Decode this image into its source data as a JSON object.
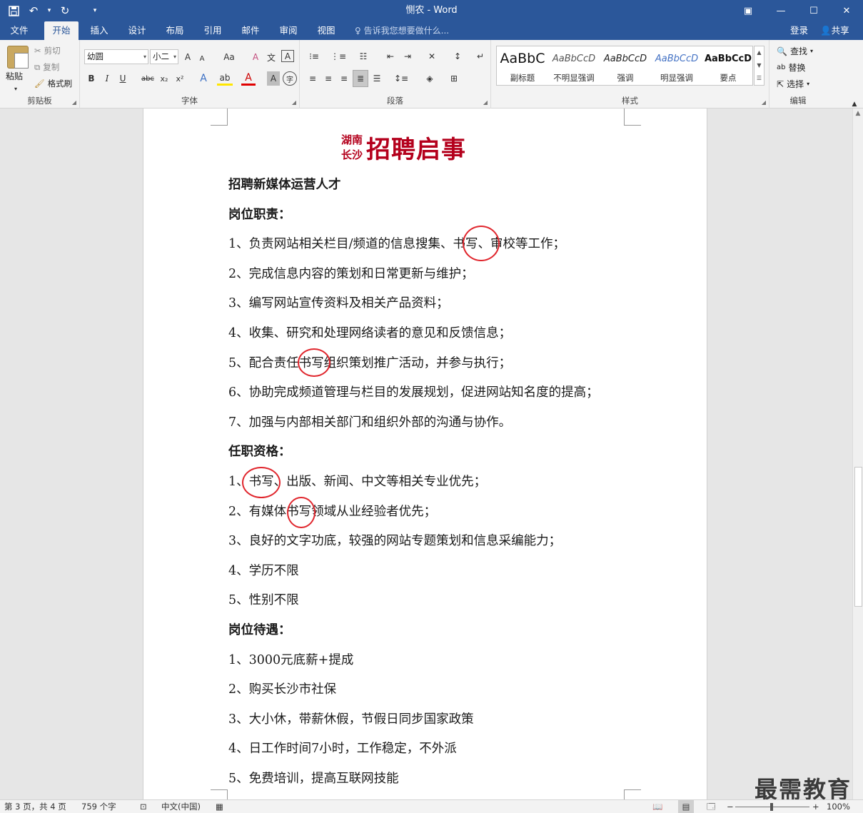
{
  "window": {
    "title": "恻农 - Word",
    "quick_access": {
      "save_icon": "save-icon",
      "undo_icon": "undo-icon",
      "redo_icon": "redo-icon",
      "customize_icon": "customize-qat-icon"
    },
    "controls": {
      "ribbon_display": "▣",
      "minimize": "—",
      "maximize": "☐",
      "close": "✕"
    }
  },
  "tabs": [
    {
      "label": "文件"
    },
    {
      "label": "开始"
    },
    {
      "label": "插入"
    },
    {
      "label": "设计"
    },
    {
      "label": "布局"
    },
    {
      "label": "引用"
    },
    {
      "label": "邮件"
    },
    {
      "label": "审阅"
    },
    {
      "label": "视图"
    }
  ],
  "tell_me": "告诉我您想要做什么...",
  "account": {
    "login": "登录",
    "share": "共享"
  },
  "ribbon": {
    "clipboard": {
      "paste": "粘贴",
      "cut": "剪切",
      "copy": "复制",
      "format_painter": "格式刷",
      "label": "剪贴板"
    },
    "font": {
      "font_name": "幼圆",
      "font_size": "小二",
      "grow": "A",
      "shrink": "A",
      "change_case": "Aa",
      "clear": "A",
      "phonetic": "文",
      "border_char": "A",
      "bold": "B",
      "italic": "I",
      "underline": "U",
      "strike": "abc",
      "subscript": "x₂",
      "superscript": "x²",
      "effects": "A",
      "highlight": "ab",
      "color": "A",
      "shading": "A",
      "enclose": "字",
      "label": "字体"
    },
    "paragraph": {
      "label": "段落"
    },
    "styles": {
      "items": [
        {
          "preview": "AaBbC",
          "name": "副标题"
        },
        {
          "preview": "AaBbCcD",
          "name": "不明显强调"
        },
        {
          "preview": "AaBbCcD",
          "name": "强调"
        },
        {
          "preview": "AaBbCcD",
          "name": "明显强调"
        },
        {
          "preview": "AaBbCcD",
          "name": "要点"
        }
      ],
      "label": "样式"
    },
    "editing": {
      "find": "查找",
      "replace": "替换",
      "select": "选择",
      "label": "编辑"
    }
  },
  "document": {
    "title_sub": "湖南长沙",
    "title_main": "招聘启事",
    "lines": [
      {
        "text": "招聘新媒体运营人才",
        "bold": true
      },
      {
        "text": "岗位职责：",
        "bold": true
      },
      {
        "text": "1、负责网站相关栏目/频道的信息搜集、书写、审校等工作；",
        "bold": false
      },
      {
        "text": "2、完成信息内容的策划和日常更新与维护；",
        "bold": false
      },
      {
        "text": "3、编写网站宣传资料及相关产品资料；",
        "bold": false
      },
      {
        "text": "4、收集、研究和处理网络读者的意见和反馈信息；",
        "bold": false
      },
      {
        "text": "5、配合责任书写组织策划推广活动，并参与执行；",
        "bold": false
      },
      {
        "text": "6、协助完成频道管理与栏目的发展规划，促进网站知名度的提高；",
        "bold": false
      },
      {
        "text": "7、加强与内部相关部门和组织外部的沟通与协作。",
        "bold": false
      },
      {
        "text": "任职资格：",
        "bold": true
      },
      {
        "text": "1、书写、出版、新闻、中文等相关专业优先；",
        "bold": false
      },
      {
        "text": "2、有媒体书写领域从业经验者优先；",
        "bold": false
      },
      {
        "text": "3、良好的文字功底，较强的网站专题策划和信息采编能力；",
        "bold": false
      },
      {
        "text": "4、学历不限",
        "bold": false
      },
      {
        "text": "5、性别不限",
        "bold": false
      },
      {
        "text": "岗位待遇：",
        "bold": true
      },
      {
        "text": "1、3000元底薪+提成",
        "bold": false
      },
      {
        "text": "2、购买长沙市社保",
        "bold": false
      },
      {
        "text": "3、大小休，带薪休假，节假日同步国家政策",
        "bold": false
      },
      {
        "text": "4、日工作时间7小时，工作稳定，不外派",
        "bold": false
      },
      {
        "text": "5、免费培训，提高互联网技能",
        "bold": false
      }
    ],
    "highlight_color": "#e0262d",
    "title_color": "#b4001c"
  },
  "status": {
    "page": "第 3 页，共 4 页",
    "words": "759 个字",
    "language": "中文(中国)",
    "zoom": "100%",
    "zoom_minus": "−",
    "zoom_plus": "+"
  },
  "watermark": "最需教育"
}
